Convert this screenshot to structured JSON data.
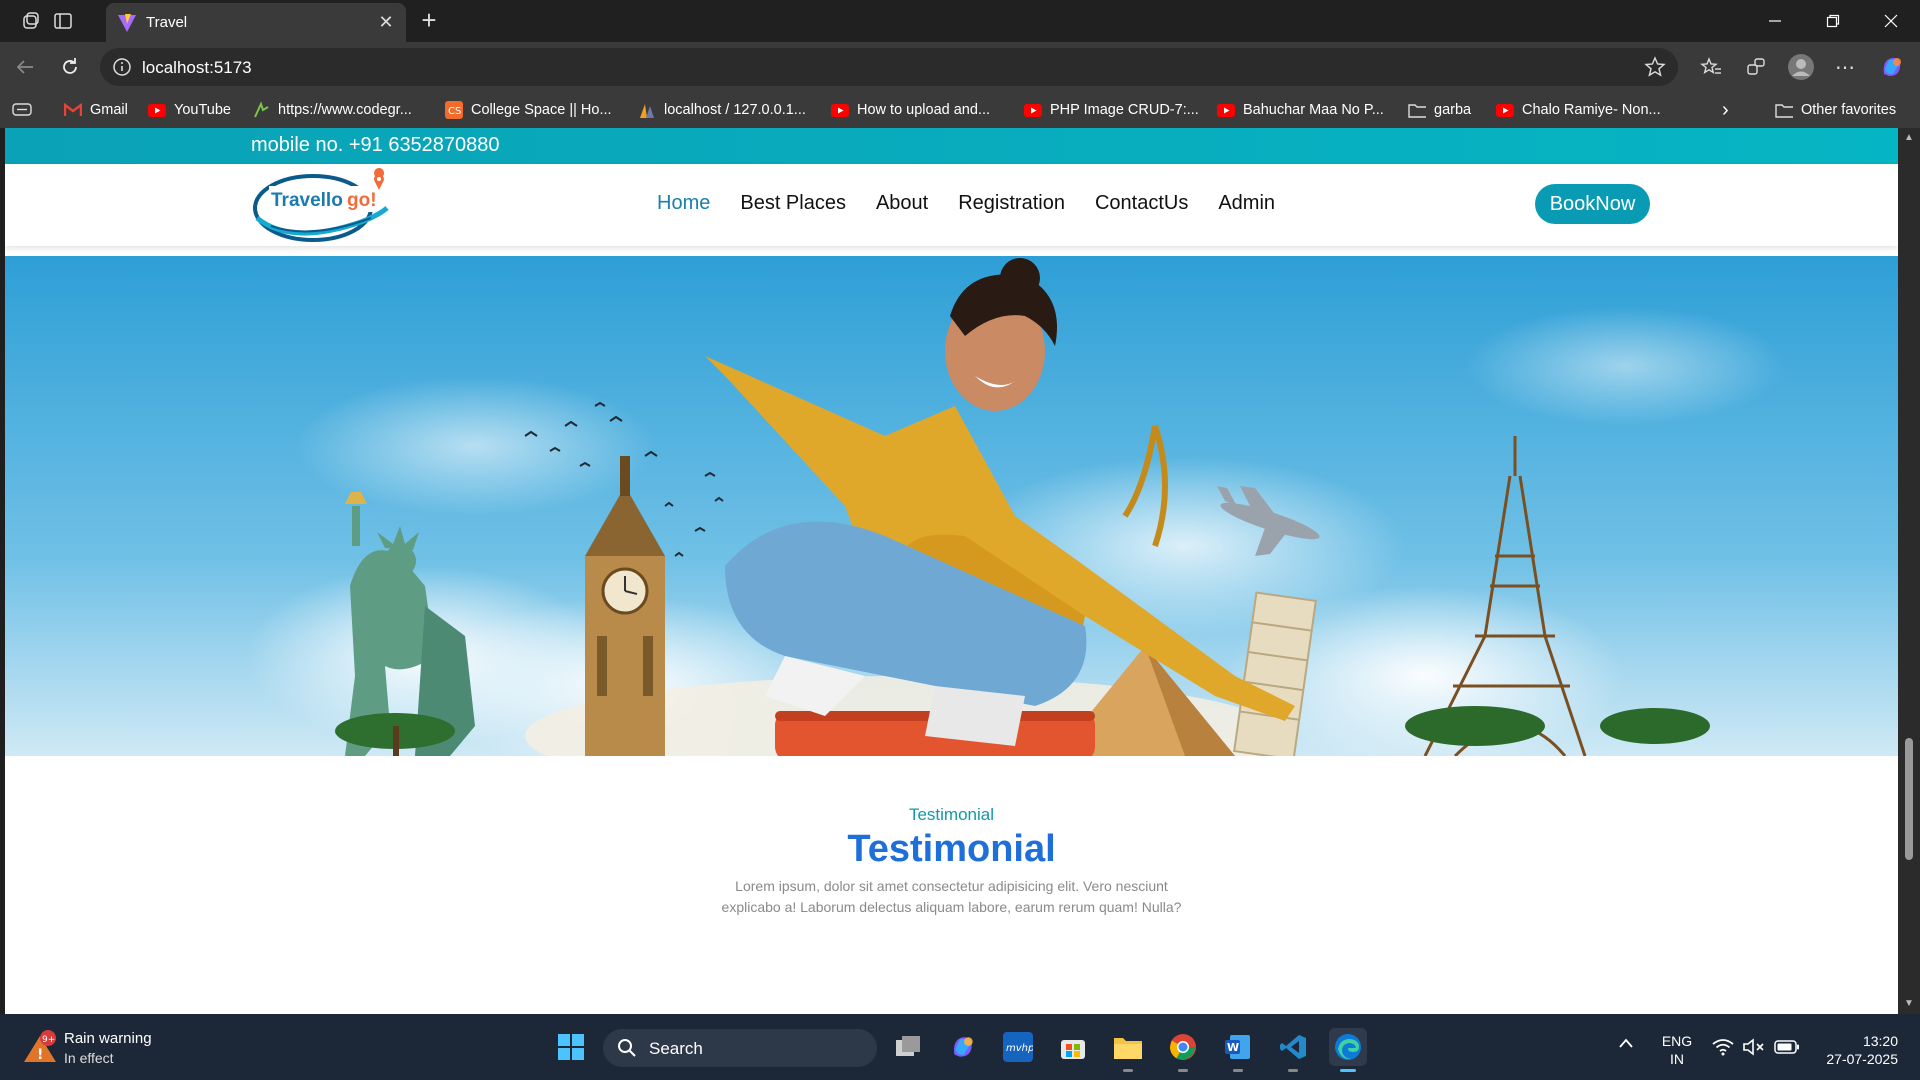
{
  "browser": {
    "tab_title": "Travel",
    "url": "localhost:5173",
    "bookmarks": [
      {
        "label": "Gmail",
        "icon": "gmail-icon"
      },
      {
        "label": "YouTube",
        "icon": "youtube-icon"
      },
      {
        "label": "https://www.codegr...",
        "icon": "codegrepper-icon"
      },
      {
        "label": "College Space || Ho...",
        "icon": "college-space-icon"
      },
      {
        "label": "localhost / 127.0.0.1...",
        "icon": "phpmyadmin-icon"
      },
      {
        "label": "How to upload and...",
        "icon": "youtube-icon"
      },
      {
        "label": "PHP Image CRUD-7:...",
        "icon": "youtube-icon"
      },
      {
        "label": "Bahuchar Maa No P...",
        "icon": "youtube-icon"
      },
      {
        "label": "garba",
        "icon": "folder-icon"
      },
      {
        "label": "Chalo Ramiye- Non...",
        "icon": "youtube-icon"
      }
    ],
    "other_favorites": "Other favorites"
  },
  "site": {
    "topbar_text": "mobile no. +91 6352870880",
    "logo_text": "Travellogo!",
    "menu": [
      "Home",
      "Best Places",
      "About",
      "Registration",
      "ContactUs",
      "Admin"
    ],
    "active_menu": "Home",
    "book_button": "BookNow",
    "testimonial": {
      "subtitle": "Testimonial",
      "title": "Testimonial",
      "line1": "Lorem ipsum, dolor sit amet consectetur adipisicing elit. Vero nesciunt",
      "line2": "explicabo a! Laborum delectus aliquam labore, earum rerum quam! Nulla?"
    }
  },
  "taskbar": {
    "weather_title": "Rain warning",
    "weather_sub": "In effect",
    "weather_badge": "9+",
    "search_label": "Search",
    "lang_top": "ENG",
    "lang_bottom": "IN",
    "time": "13:20",
    "date": "27-07-2025"
  },
  "colors": {
    "accent": "#0a9bb4",
    "testimonial_title": "#1e6fd9",
    "topbar": "#06b5c3"
  }
}
